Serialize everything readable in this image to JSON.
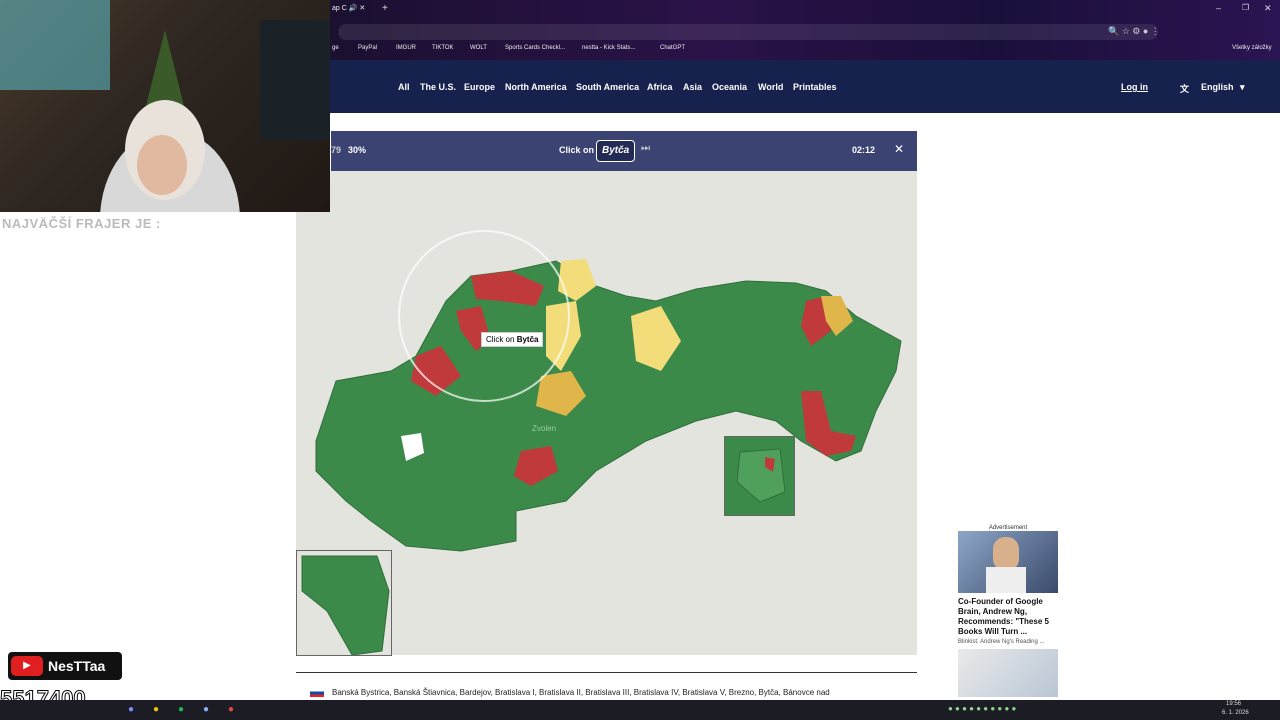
{
  "browser": {
    "tab_title": "ap C",
    "bookmarks": [
      "ge",
      "PayPal",
      "IMGUR",
      "TIKTOK",
      "WOLT",
      "Sports Cards Checkl...",
      "nestta - Kick Stats...",
      "ChatGPT"
    ],
    "bookmarks_right": "Všetky záložky"
  },
  "nav": {
    "items": [
      "All",
      "The U.S.",
      "Europe",
      "North America",
      "South America",
      "Africa",
      "Asia",
      "Oceania",
      "World",
      "Printables"
    ],
    "login": "Log in",
    "language": "English"
  },
  "game": {
    "score_left": "79",
    "percent": "30%",
    "prompt": "Click on",
    "target": "Bytča",
    "timer": "02:12",
    "tooltip_prefix": "Click on",
    "tooltip_target": "Bytča",
    "city_label": "Zvolen"
  },
  "region_list": "Banská Bystrica, Banská Štiavnica, Bardejov, Bratislava I, Bratislava II, Bratislava III, Bratislava IV, Bratislava V, Brezno, Bytča, Bánovce nad",
  "stream": {
    "overlay_text": "NAJVÄČŠÍ FRAJER JE :",
    "channel": "NesTTaa",
    "counter": "5517400"
  },
  "ad": {
    "label": "Advertisement",
    "headline": "Co-Founder of Google Brain, Andrew Ng, Recommends: \"These 5 Books Will Turn ...",
    "source": "Blinkist: Andrew Ng's Reading ..."
  },
  "taskbar": {
    "time": "19:56",
    "date": "6. 1. 2026"
  },
  "colors": {
    "nav_bg": "#16214e",
    "game_bar": "#3a4372",
    "green": "#3c8a4a",
    "red": "#c0393b",
    "yellow": "#f2dd7a",
    "orange": "#e0b54a"
  }
}
